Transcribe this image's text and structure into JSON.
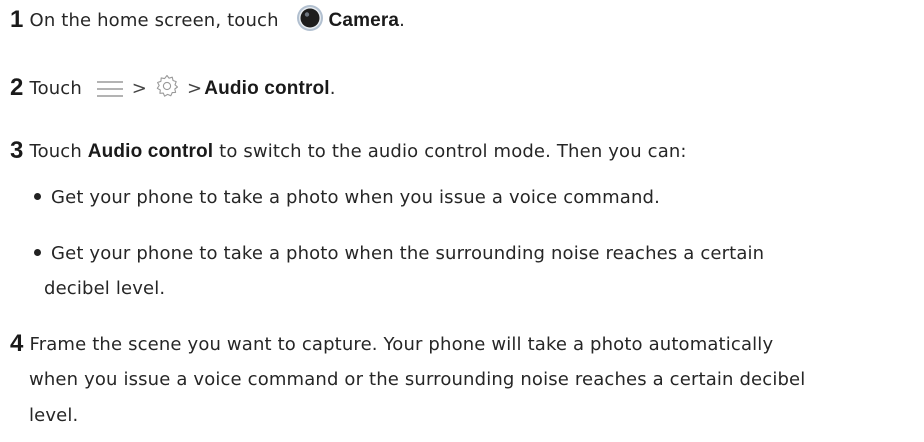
{
  "steps": {
    "s1": {
      "num": "1",
      "text": "On the home screen, touch",
      "bold": "Camera",
      "end": "."
    },
    "s2": {
      "num": "2",
      "text": "Touch",
      "sep1": ">",
      "sep2": ">",
      "bold": "Audio control",
      "end": "."
    },
    "s3": {
      "num": "3",
      "pre": "Touch",
      "bold": "Audio control",
      "post": "to switch to the audio control mode. Then you can:"
    },
    "b1": "Get your phone to take a photo when you issue a voice command.",
    "b2_line1": "Get your phone to take a photo when the surrounding noise reaches a certain",
    "b2_line2": "decibel level.",
    "s4": {
      "num": "4",
      "line1": "Frame the scene you want to capture. Your phone will take a photo automatically",
      "line2": "when you issue a voice command or the surrounding noise reaches a certain decibel",
      "line3": "level."
    }
  },
  "icons": {
    "camera": "camera-icon",
    "menu": "menu-icon",
    "settings": "settings-gear-icon"
  },
  "colors": {
    "text": "#262626",
    "camera_outer": "#a9b8c9",
    "camera_inner": "#1e1e1e"
  }
}
